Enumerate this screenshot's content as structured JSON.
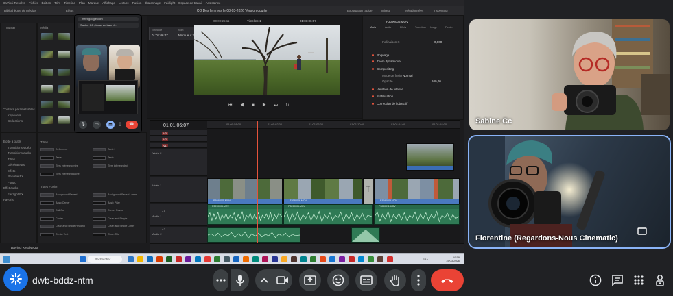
{
  "meeting": {
    "code": "dwb-bddz-ntm"
  },
  "participants": [
    {
      "name": "Sabine Cc"
    },
    {
      "name": "Florentine (Regardons-Nous Cinematic)"
    }
  ],
  "shared_screen": {
    "app": "DaVinci Resolve",
    "project_title": "CO Des femmes le 08-03-2026  Version courte",
    "menu": [
      "DaVinci Resolve",
      "Fichier",
      "Édition",
      "Trim",
      "Timeline",
      "Plan",
      "Marque",
      "Affichage",
      "Lecture",
      "Fusion",
      "Étalonnage",
      "Fairlight",
      "Espace de travail",
      "Assistance"
    ],
    "toolbar": {
      "media_library": "Bibliothèque de médias",
      "effects": "Effets",
      "export": "Exportation rapide",
      "mixer": "Mixeur",
      "metadata": "Métadonnées",
      "inspector": "Inspecteur"
    },
    "left_panel": {
      "master": "Master",
      "smart_bins": "Chutiers paramétrables",
      "keywords": "Keywords",
      "collections": "Collections"
    },
    "effects_panel": {
      "tree": [
        "Boîte à outils",
        "Transitions vidéo",
        "Transitions audio",
        "Titres",
        "Générateurs",
        "Effets",
        "Resolve FX",
        "Fondu",
        "Effet audio",
        "Fairlight FX",
        "Favoris"
      ],
      "section_titles": "Titres",
      "section_fusion": "Titres Fusion",
      "items_left": [
        "Défilement",
        "Texte",
        "Tiers inférieur centre",
        "Tiers inférieur gauche"
      ],
      "items_right": [
        "Texte+",
        "Texte",
        "Tiers inférieur droit"
      ],
      "fusion_left": [
        "Background Reveal",
        "Basic Center",
        "Call Out",
        "Center",
        "Clean and Simple Heading",
        "Center Text"
      ],
      "fusion_right": [
        "Background Reveal Lower",
        "Basic Pillar",
        "Corner Reveal",
        "Clean and Simple",
        "Clean and Simple Lower",
        "Clean Title"
      ]
    },
    "viewer": {
      "timecode_label": "Timecode",
      "timecode": "01:01:06:07",
      "name_label": "Nom",
      "name": "Marqueur 2",
      "zoom": "39%",
      "duration": "00:09:25:11",
      "timeline_label": "Timeline 1",
      "current_tc": "01:01:06:07"
    },
    "inspector": {
      "clip": "P3090005.MOV",
      "tabs": [
        "Vidéo",
        "Audio",
        "Effets",
        "Transition",
        "Image",
        "Fichier"
      ],
      "sections": [
        "Rognage",
        "Zoom dynamique",
        "Compositing",
        "Variation de vitesse",
        "Stabilisation",
        "Correction de l'objectif"
      ],
      "composite_mode_label": "Mode de fusion",
      "composite_mode": "Normal",
      "opacity_label": "Opacité",
      "opacity": "100,00",
      "rotation_label": "Inclinaison X",
      "rotation_value": "0,000"
    },
    "timeline": {
      "timecode": "01:01:06:07",
      "tracks": [
        "V3",
        "V2",
        "V1",
        "A1",
        "A2"
      ],
      "track_labels": [
        "Vidéo 2",
        "Vidéo 1",
        "Audio 1",
        "Audio 2"
      ],
      "clip_names": [
        "P3090005.MOV",
        "P3090005.MOV",
        "P3090006.MOV",
        "P3090009.MOV",
        "P3090011.MOV"
      ],
      "ruler": [
        "01:00:58:00",
        "01:01:02:00",
        "01:01:06:00",
        "01:01:10:00",
        "01:01:14:00",
        "01:01:18:00"
      ],
      "version": "DaVinci Resolve 20",
      "export_label": "Exporter"
    },
    "mini_meet": {
      "url": "meet.google.com",
      "header": "Sabine CC (Vous, en train d…",
      "tiles": [
        "Florentine Ro…",
        "Sabine Cc"
      ]
    },
    "taskbar": {
      "search": "Rechercher",
      "time": "19:59",
      "date": "15/03/2026",
      "lang": "FRA"
    }
  },
  "icons": {
    "more": "more-horiz-icon",
    "mic": "mic-icon",
    "chevron": "chevron-up-icon",
    "camera": "videocam-icon",
    "present": "present-icon",
    "emoji": "emoji-icon",
    "captions": "captions-icon",
    "hand": "raise-hand-icon",
    "more_vert": "more-vert-icon",
    "end": "call-end-icon",
    "info": "info-icon",
    "chat": "chat-icon",
    "activities": "apps-icon",
    "host": "host-controls-icon"
  },
  "colors": {
    "background": "#202124",
    "button": "#3c4043",
    "end_call": "#ea4335",
    "accent": "#8ab4f8",
    "logo": "#1a73e8"
  }
}
